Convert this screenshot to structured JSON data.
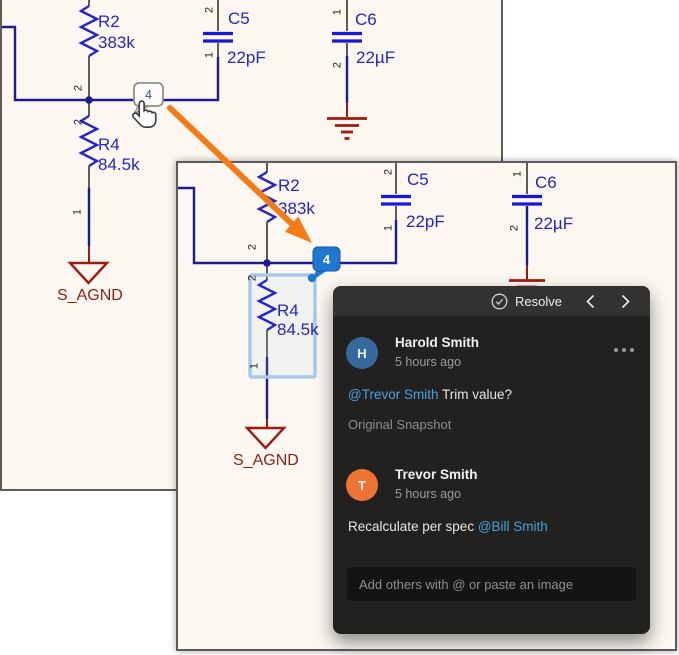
{
  "schematic": {
    "marker_number": "4",
    "pins": {
      "p1": "1",
      "p2": "2"
    },
    "components": {
      "r2": {
        "ref": "R2",
        "value": "383k"
      },
      "r4": {
        "ref": "R4",
        "value": "84.5k"
      },
      "c5": {
        "ref": "C5",
        "value": "22pF"
      },
      "c6": {
        "ref": "C6",
        "value": "22µF"
      },
      "ground_net": "S_AGND"
    }
  },
  "comment_panel": {
    "resolve_label": "Resolve",
    "comments": [
      {
        "author": "Harold Smith",
        "initial": "H",
        "time": "5 hours ago",
        "mention": "@Trevor Smith",
        "text": " Trim value?",
        "note": "Original Snapshot"
      },
      {
        "author": "Trevor Smith",
        "initial": "T",
        "time": "5 hours ago",
        "text": "Recalculate per spec ",
        "mention": "@Bill Smith"
      }
    ],
    "input_placeholder": "Add others with @ or paste an image"
  },
  "colors": {
    "sheet_background": "#fcf8f1",
    "wire_navy": "#1c1c8f",
    "component_blue": "#2424d0",
    "label_blue": "#2525c4",
    "ground_red": "#9c1b0e",
    "arrow_orange": "#f57b17",
    "marker_blue": "#1e78d2",
    "selection_blue": "#a9c9ea",
    "mention_blue": "#4aa1dd",
    "avatar_blue": "#36699e",
    "avatar_orange": "#ee7434",
    "panel_background": "#232120"
  }
}
